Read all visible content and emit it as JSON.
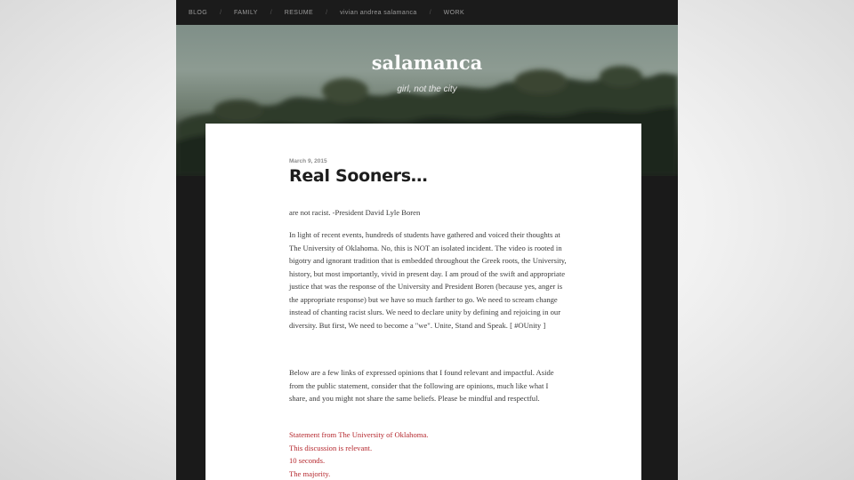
{
  "nav": {
    "items": [
      {
        "label": "BLOG"
      },
      {
        "label": "FAMILY"
      },
      {
        "label": "RESUME"
      },
      {
        "label": "vivian andrea salamanca"
      },
      {
        "label": "WORK"
      }
    ],
    "separator": "/"
  },
  "header": {
    "site_title": "salamanca",
    "tagline": "girl, not the city"
  },
  "post": {
    "date": "March 9, 2015",
    "title": "Real Sooners…",
    "quote": "are not racist. -President David Lyle Boren",
    "paragraph1": "In light of recent events, hundreds of students have gathered and voiced their thoughts at The University of Oklahoma. No, this is NOT an isolated incident. The video is rooted in bigotry and ignorant tradition that is embedded throughout the Greek roots, the University, history, but most importantly, vivid in present day. I am proud of the swift and appropriate justice that was the response of the University and President Boren (because yes, anger is the appropriate response) but we have so much farther to go. We need to scream change instead of chanting racist slurs. We need to declare unity by defining and rejoicing in our diversity. But first, We need to become a \"we\". Unite, Stand and Speak. [ #OUnity ]",
    "paragraph2": "Below are a few links of expressed opinions that I found relevant and impactful. Aside from the public statement, consider that the following are opinions, much like what I share, and you might not share the same beliefs. Please be mindful and respectful.",
    "links": [
      {
        "label": "Statement from The University of Oklahoma."
      },
      {
        "label": "This discussion is relevant."
      },
      {
        "label": "10 seconds."
      },
      {
        "label": "The majority."
      }
    ]
  },
  "colors": {
    "link": "#b5282e",
    "nav_bg": "#1b1b1b",
    "page_bg": "#1a1a1a"
  }
}
